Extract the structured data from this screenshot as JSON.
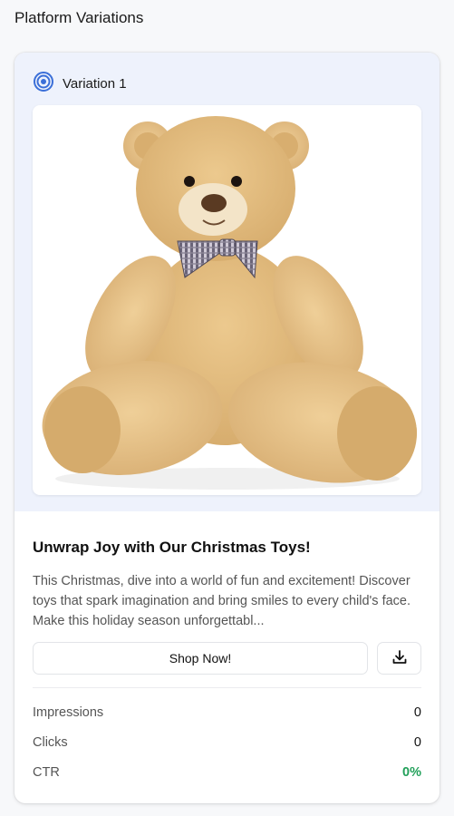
{
  "page": {
    "title": "Platform Variations"
  },
  "variation": {
    "label": "Variation 1",
    "image_alt": "teddy-bear",
    "headline": "Unwrap Joy with Our Christmas Toys!",
    "description": "This Christmas, dive into a world of fun and excitement! Discover toys that spark imagination and bring smiles to every child's face. Make this holiday season unforgettabl...",
    "cta_label": "Shop Now!",
    "icons": {
      "variation": "target-icon",
      "download": "download-icon"
    }
  },
  "stats": {
    "impressions_label": "Impressions",
    "impressions_value": "0",
    "clicks_label": "Clicks",
    "clicks_value": "0",
    "ctr_label": "CTR",
    "ctr_value": "0%"
  },
  "colors": {
    "accent": "#3b6fd8",
    "ctr_green": "#22a05a",
    "card_top_bg": "#eef2fc"
  }
}
